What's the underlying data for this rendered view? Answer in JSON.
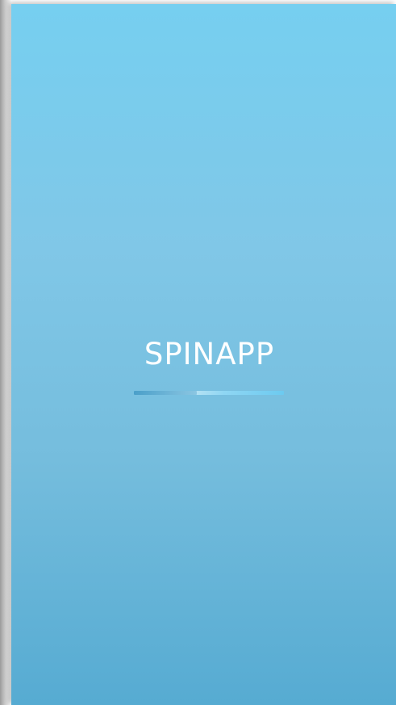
{
  "splash": {
    "app_name": "SPINAPP",
    "loading_progress": 0.42
  },
  "colors": {
    "background_top": "#76cff0",
    "background_bottom": "#56abd2",
    "text": "#ffffff",
    "progress_fill": "#4a9fc9",
    "progress_track": "#9fdaf1"
  }
}
